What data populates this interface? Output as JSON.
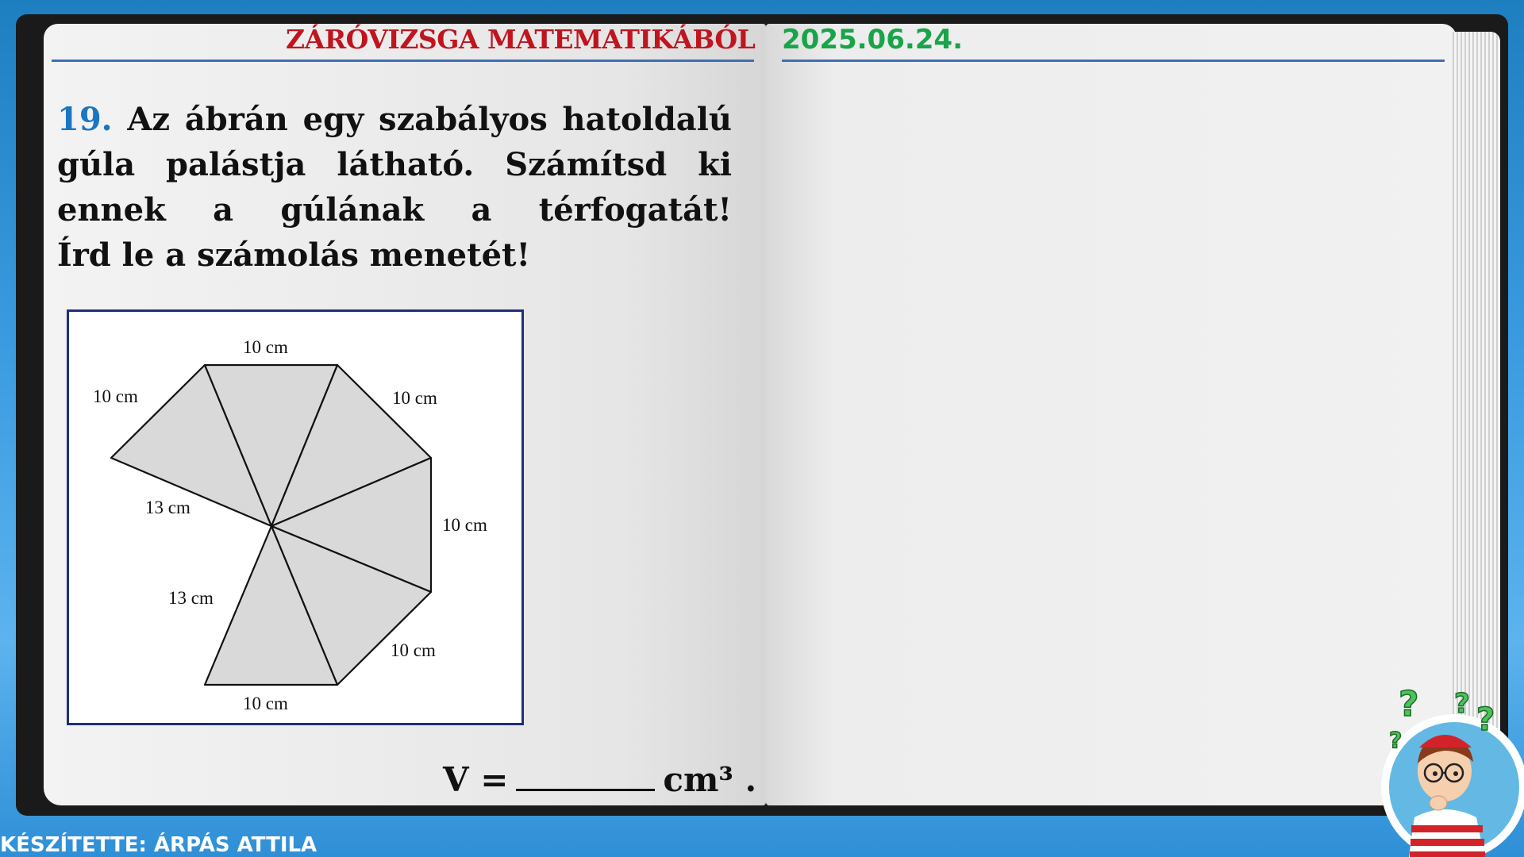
{
  "header": {
    "title": "ZÁRÓVIZSGA MATEMATIKÁBÓL",
    "date": "2025.06.24."
  },
  "question": {
    "number": "19.",
    "text": "Az ábrán egy szabályos hatoldalú gúla palástja látható. Számítsd ki ennek a gúlának a térfogatát!",
    "instruction": "Írd le a számolás menetét!"
  },
  "figure": {
    "labels": {
      "top": "10 cm",
      "upper_left": "10 cm",
      "upper_right": "10 cm",
      "right": "10 cm",
      "lower_right": "10 cm",
      "bottom": "10 cm",
      "slant_upper": "13 cm",
      "slant_lower": "13 cm"
    },
    "colors": {
      "face_fill": "#d9d9d9",
      "stroke": "#111111",
      "frame": "#1f2f7a"
    }
  },
  "answer": {
    "prefix": "V =",
    "unit": "cm³ ."
  },
  "footer": {
    "author": "KÉSZÍTETTE: ÁRPÁS ATTILA"
  },
  "colors": {
    "title_red": "#c0151e",
    "date_green": "#1aa44a",
    "question_number_blue": "#1a76c2",
    "background_blue": "#2f8fd6"
  }
}
